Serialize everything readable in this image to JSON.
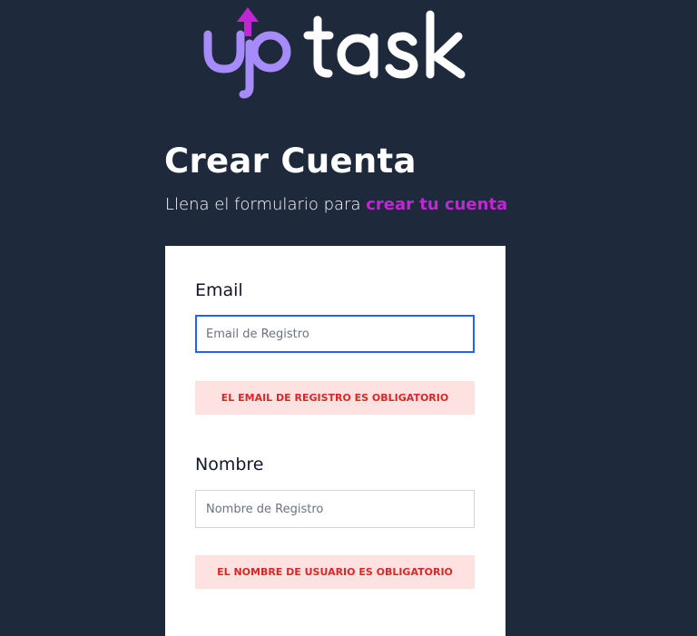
{
  "brand": {
    "logo_text": "uptask",
    "primary_color": "#a78bfa",
    "arrow_color": "#c026d3"
  },
  "page": {
    "title": "Crear Cuenta",
    "subtitle_prefix": "Llena el formulario para ",
    "subtitle_highlight": "crear tu cuenta",
    "background": "#1e293b"
  },
  "form": {
    "email": {
      "label": "Email",
      "placeholder": "Email de Registro",
      "value": "",
      "error": "EL EMAIL DE REGISTRO ES OBLIGATORIO"
    },
    "nombre": {
      "label": "Nombre",
      "placeholder": "Nombre de Registro",
      "value": "",
      "error": "EL NOMBRE DE USUARIO ES OBLIGATORIO"
    }
  },
  "colors": {
    "accent": "#c026d3",
    "error_bg": "#fee2e2",
    "error_text": "#dc2626",
    "focus": "#2563eb"
  }
}
